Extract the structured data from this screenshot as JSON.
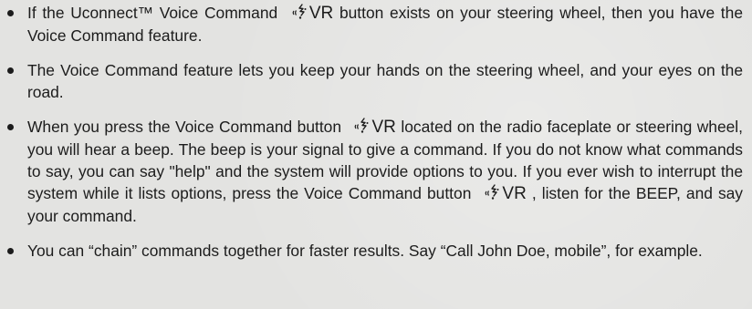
{
  "items": [
    {
      "segments": [
        {
          "type": "text",
          "value": "If the Uconnect™ Voice Command "
        },
        {
          "type": "icon",
          "icon": "voice-command-icon",
          "label": "VR"
        },
        {
          "type": "text",
          "value": " button exists on your steering wheel, then you have the Voice Command feature."
        }
      ]
    },
    {
      "segments": [
        {
          "type": "text",
          "value": "The Voice Command feature lets you keep your hands on the steering wheel, and your eyes on the road."
        }
      ]
    },
    {
      "segments": [
        {
          "type": "text",
          "value": "When you press the Voice Command button "
        },
        {
          "type": "icon",
          "icon": "voice-command-icon",
          "label": "VR"
        },
        {
          "type": "text",
          "value": " located on the radio faceplate or steering wheel, you will hear a beep. The beep is your signal to give a command. If you do not know what commands to say, you can say \"help\" and the system will provide options to you. If you ever wish to interrupt the system while it lists options, press the Voice Command button "
        },
        {
          "type": "icon",
          "icon": "voice-command-icon",
          "label": "VR"
        },
        {
          "type": "text",
          "value": " , listen for the BEEP, and say your command."
        }
      ]
    },
    {
      "segments": [
        {
          "type": "text",
          "value": "You can “chain” commands together for faster results. Say “Call John Doe, mobile”, for example."
        }
      ]
    }
  ]
}
